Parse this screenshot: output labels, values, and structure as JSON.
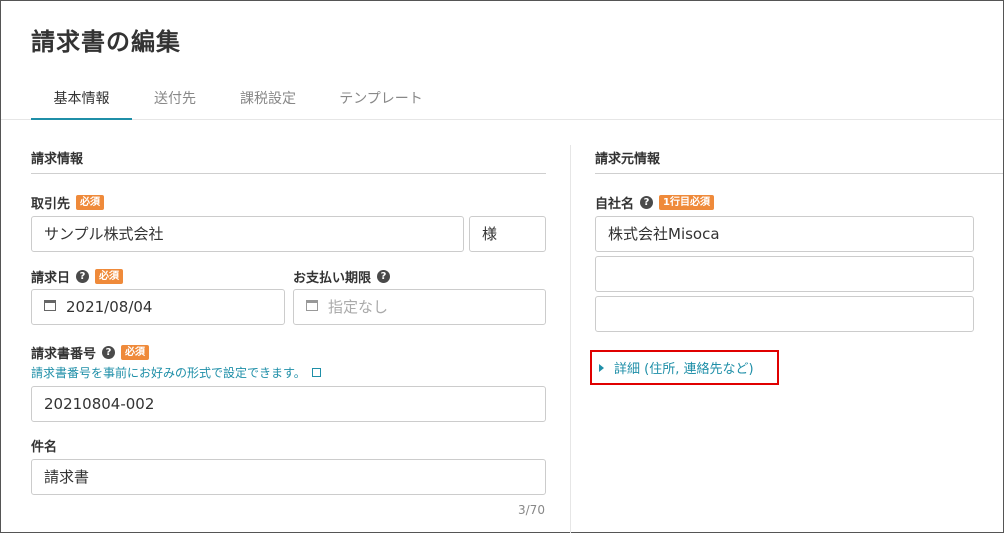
{
  "page": {
    "title": "請求書の編集"
  },
  "tabs": [
    {
      "label": "基本情報",
      "active": true
    },
    {
      "label": "送付先"
    },
    {
      "label": "課税設定"
    },
    {
      "label": "テンプレート"
    }
  ],
  "billing_info": {
    "heading": "請求情報",
    "client": {
      "label": "取引先",
      "required": "必須",
      "value": "サンプル株式会社",
      "suffix": "様"
    },
    "invoice_date": {
      "label": "請求日",
      "required": "必須",
      "value": "2021/08/04"
    },
    "due_date": {
      "label": "お支払い期限",
      "placeholder": "指定なし"
    },
    "invoice_number": {
      "label": "請求書番号",
      "required": "必須",
      "hint": "請求書番号を事前にお好みの形式で設定できます。",
      "value": "20210804-002"
    },
    "subject": {
      "label": "件名",
      "value": "請求書",
      "counter": "3/70"
    }
  },
  "issuer_info": {
    "heading": "請求元情報",
    "company_name": {
      "label": "自社名",
      "required": "1行目必須",
      "line1": "株式会社Misoca",
      "line2": "",
      "line3": ""
    },
    "details_link": "詳細 (住所, 連絡先など)"
  },
  "colors": {
    "accent": "#1f8fa8",
    "required_badge": "#ef8a3a",
    "highlight": "#e00000"
  }
}
